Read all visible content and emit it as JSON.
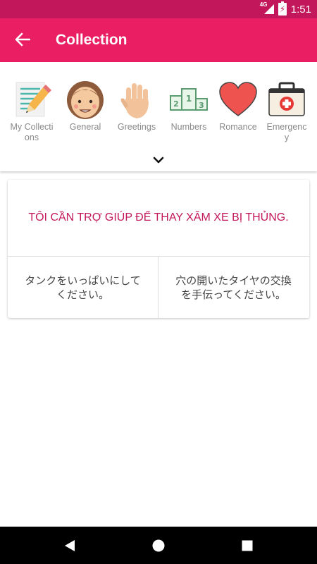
{
  "status_bar": {
    "network": "4G",
    "time": "1:51"
  },
  "app_bar": {
    "title": "Collection",
    "back_icon": "arrow-left-icon"
  },
  "categories": [
    {
      "label": "My Collections",
      "icon": "notepad-pencil-icon"
    },
    {
      "label": "General",
      "icon": "girl-face-icon"
    },
    {
      "label": "Greetings",
      "icon": "waving-hand-icon"
    },
    {
      "label": "Numbers",
      "icon": "podium-icon"
    },
    {
      "label": "Romance",
      "icon": "heart-icon"
    },
    {
      "label": "Emergency",
      "icon": "first-aid-kit-icon"
    }
  ],
  "expand_icon": "chevron-down-icon",
  "card": {
    "phrase": "TÔI CẦN TRỢ GIÚP ĐỂ THAY XĂM XE BỊ THỦNG.",
    "options": [
      "タンクをいっぱいにしてください。",
      "穴の開いたタイヤの交換を手伝ってください。"
    ]
  },
  "colors": {
    "status_bar": "#c2185b",
    "app_bar": "#e91e63",
    "phrase_text": "#c2185b"
  }
}
